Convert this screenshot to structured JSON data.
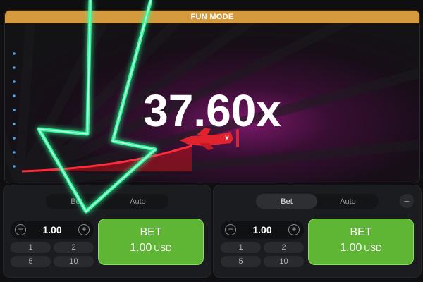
{
  "banner": {
    "label": "FUN MODE"
  },
  "game": {
    "multiplier": "37.60x"
  },
  "panels": [
    {
      "tabs": [
        "Bet",
        "Auto"
      ],
      "active_tab": 1,
      "amount": "1.00",
      "chips": [
        "1",
        "2",
        "5",
        "10"
      ],
      "bet_label": "BET",
      "bet_amount": "1.00",
      "currency": "USD"
    },
    {
      "tabs": [
        "Bet",
        "Auto"
      ],
      "active_tab": 0,
      "amount": "1.00",
      "chips": [
        "1",
        "2",
        "5",
        "10"
      ],
      "bet_label": "BET",
      "bet_amount": "1.00",
      "currency": "USD",
      "remove_symbol": "−"
    }
  ],
  "colors": {
    "accent": "#d49a3d",
    "bet_green": "#5fb534",
    "plane_red": "#e0232e",
    "arrow": "#2bff9a"
  }
}
